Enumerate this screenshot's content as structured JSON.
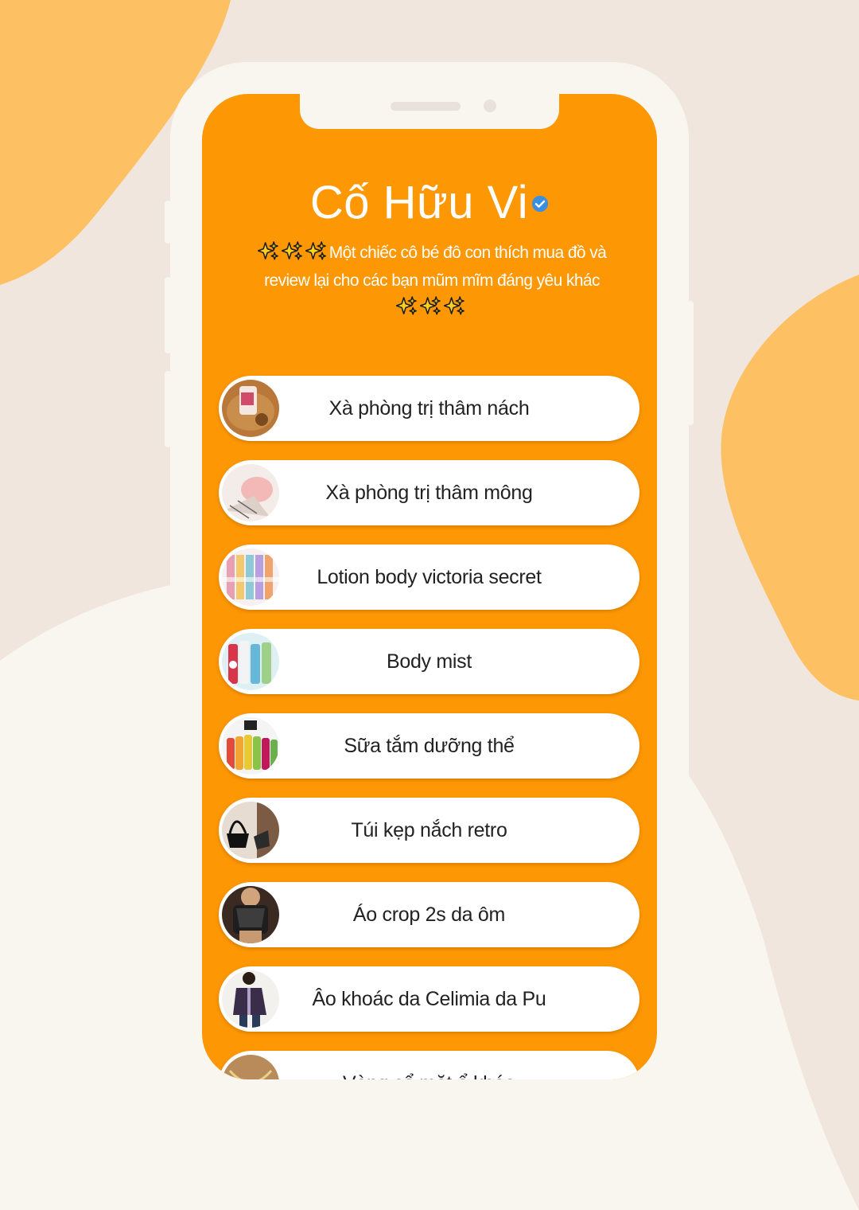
{
  "colors": {
    "page_background": "#f0e6dd",
    "blob": "#fdc062",
    "phone_frame": "#f9f5ef",
    "screen_background": "#fd9703",
    "button_background": "#ffffff",
    "button_text": "#222222",
    "verified_badge": "#3b8fe0"
  },
  "profile": {
    "name": "Cố Hữu Vi",
    "verified": true,
    "verified_icon": "verified-check-icon",
    "bio_prefix_icons": [
      "sparkles-icon",
      "sparkles-icon",
      "sparkles-icon"
    ],
    "bio_text": "Một chiếc cô bé đô con thích mua đồ và review lại cho các bạn mũm mĩm đáng yêu khác",
    "bio_suffix_icons": [
      "sparkles-icon",
      "sparkles-icon",
      "sparkles-icon"
    ]
  },
  "links": [
    {
      "label": "Xà phòng trị thâm nách",
      "thumbnail": "soap-bar-thumbnail"
    },
    {
      "label": "Xà phòng trị thâm mông",
      "thumbnail": "pink-soap-thumbnail"
    },
    {
      "label": "Lotion body victoria secret",
      "thumbnail": "lotion-bottles-thumbnail"
    },
    {
      "label": "Body mist",
      "thumbnail": "body-mist-thumbnail"
    },
    {
      "label": "Sữa tắm dưỡng thể",
      "thumbnail": "shower-gel-thumbnail"
    },
    {
      "label": "Túi kẹp nắch retro",
      "thumbnail": "handbag-thumbnail"
    },
    {
      "label": "Áo crop 2s da ôm",
      "thumbnail": "crop-top-thumbnail"
    },
    {
      "label": "Âo khoác da Celimia da Pu",
      "thumbnail": "leather-jacket-thumbnail"
    },
    {
      "label": "Vòng cổ mặt ổ khóa",
      "thumbnail": "padlock-necklace-thumbnail"
    }
  ]
}
